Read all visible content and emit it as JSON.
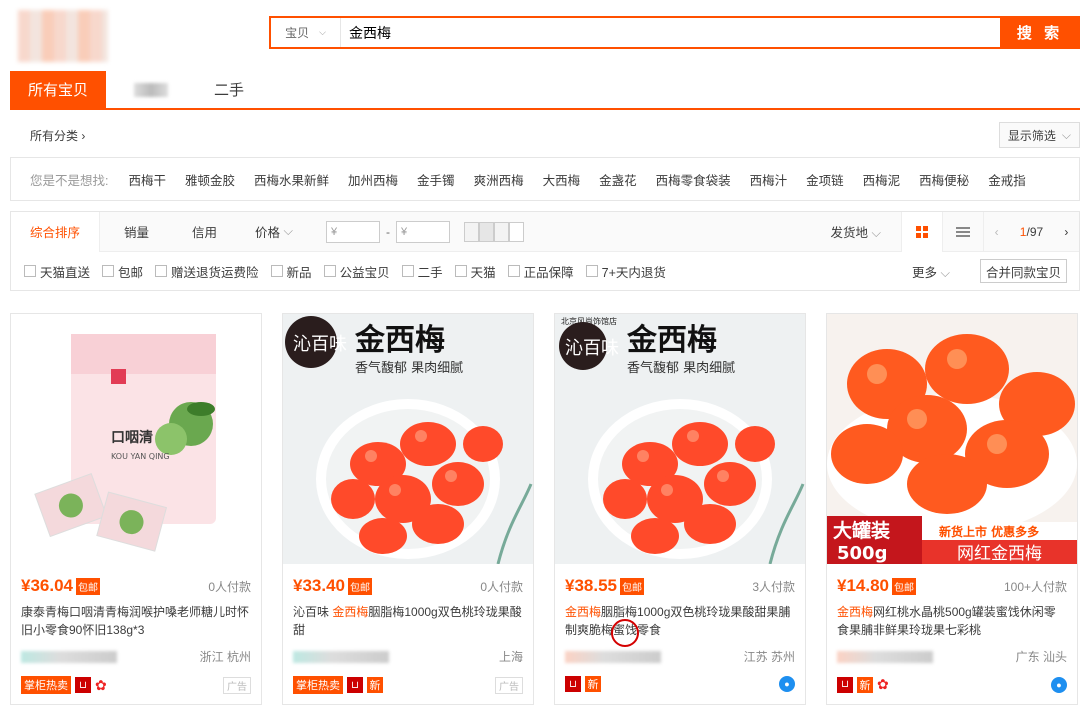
{
  "header": {
    "search_category": "宝贝",
    "search_query": "金西梅",
    "search_button": "搜 索"
  },
  "tabs": [
    {
      "label": "所有宝贝"
    },
    {
      "label": ""
    },
    {
      "label": "二手"
    }
  ],
  "category": {
    "all_label": "所有分类",
    "filter_label": "显示筛选"
  },
  "suggestions": {
    "label": "您是不是想找:",
    "items": [
      "西梅干",
      "雅顿金胶",
      "西梅水果新鲜",
      "加州西梅",
      "金手镯",
      "爽洲西梅",
      "大西梅",
      "金盏花",
      "西梅零食袋装",
      "西梅汁",
      "金项链",
      "西梅泥",
      "西梅便秘",
      "金戒指"
    ]
  },
  "sort": {
    "items": [
      "综合排序",
      "销量",
      "信用",
      "价格"
    ],
    "price_from_placeholder": "¥",
    "price_to_placeholder": "¥",
    "dash": "-",
    "ship_from": "发货地",
    "page_current": "1",
    "page_total": "/97"
  },
  "filters": {
    "checkboxes": [
      "天猫直送",
      "包邮",
      "赠送退货运费险",
      "新品",
      "公益宝贝",
      "二手",
      "天猫",
      "正品保障",
      "7+天内退货"
    ],
    "more": "更多",
    "merge": "合并同款宝贝"
  },
  "products": [
    {
      "price": "¥36.04",
      "mail_badge": "包邮",
      "buyers": "0人付款",
      "title_pre": "康泰青梅口咽清青梅润喉护嗓老师糖儿时怀旧小零食90怀旧138g*3",
      "title_hl": "",
      "title_post": "",
      "location": "浙江 杭州",
      "tag1": "掌柜热卖",
      "ad": "广告"
    },
    {
      "price": "¥33.40",
      "mail_badge": "包邮",
      "buyers": "0人付款",
      "title_pre": "沁百味 ",
      "title_hl": "金西梅",
      "title_post": "胭脂梅1000g双色桃玲珑果酸甜",
      "location": "上海",
      "tag1": "掌柜热卖",
      "tag_new": "新",
      "ad": "广告"
    },
    {
      "price": "¥38.55",
      "mail_badge": "包邮",
      "buyers": "3人付款",
      "title_pre": "",
      "title_hl": "金西梅",
      "title_post": "胭脂梅1000g双色桃玲珑果酸甜果脯制爽脆梅蜜饯零食",
      "location": "江苏 苏州",
      "tag_new": "新"
    },
    {
      "price": "¥14.80",
      "mail_badge": "包邮",
      "buyers": "100+人付款",
      "title_pre": "",
      "title_hl": "金西梅",
      "title_post": "网红桃水晶桃500g罐装蜜饯休闲零食果脯非鲜果玲珑果七彩桃",
      "location": "广东 汕头",
      "tag_new": "新"
    }
  ],
  "images": {
    "p2_title": "金西梅",
    "p2_sub": "香气馥郁 果肉细腻",
    "p2_brand": "沁百味",
    "p3_title": "金西梅",
    "p3_sub": "香气馥郁 果肉细腻",
    "p3_brand": "沁百味",
    "p3_shop": "北京风尚饰馆店",
    "p4_banner1": "大罐装",
    "p4_banner2": "500g",
    "p4_banner3": "新货上市 优惠多多",
    "p4_banner4": "网红金西梅",
    "p1_pack_name": "口咽清",
    "p1_pack_pinyin": "KOU YAN QING"
  },
  "colors": {
    "accent": "#ff5000",
    "text": "#3c3c3c",
    "muted": "#888888"
  }
}
